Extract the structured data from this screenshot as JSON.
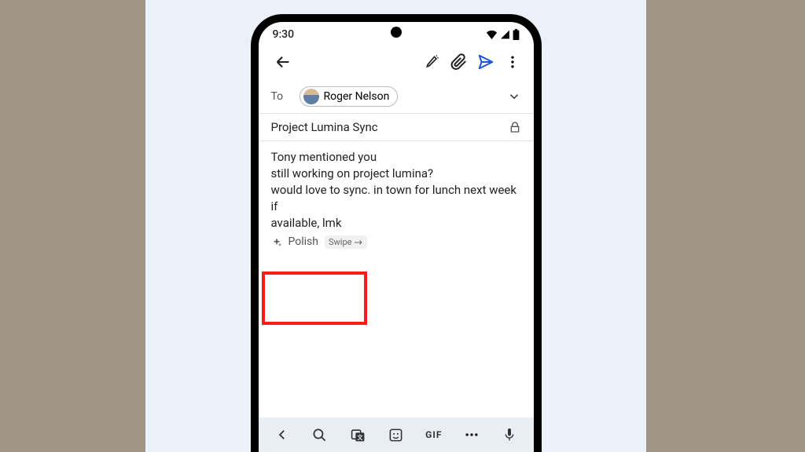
{
  "status": {
    "time": "9:30"
  },
  "compose": {
    "to_label": "To",
    "recipient": "Roger Nelson",
    "subject": "Project Lumina Sync",
    "body_lines": [
      "Tony mentioned you",
      "still working on project lumina?",
      "would love to sync. in town for lunch next week if",
      "available, lmk"
    ],
    "suggestion": {
      "label": "Polish",
      "hint": "Swipe"
    }
  },
  "keyboard": {
    "gif_label": "GIF"
  }
}
